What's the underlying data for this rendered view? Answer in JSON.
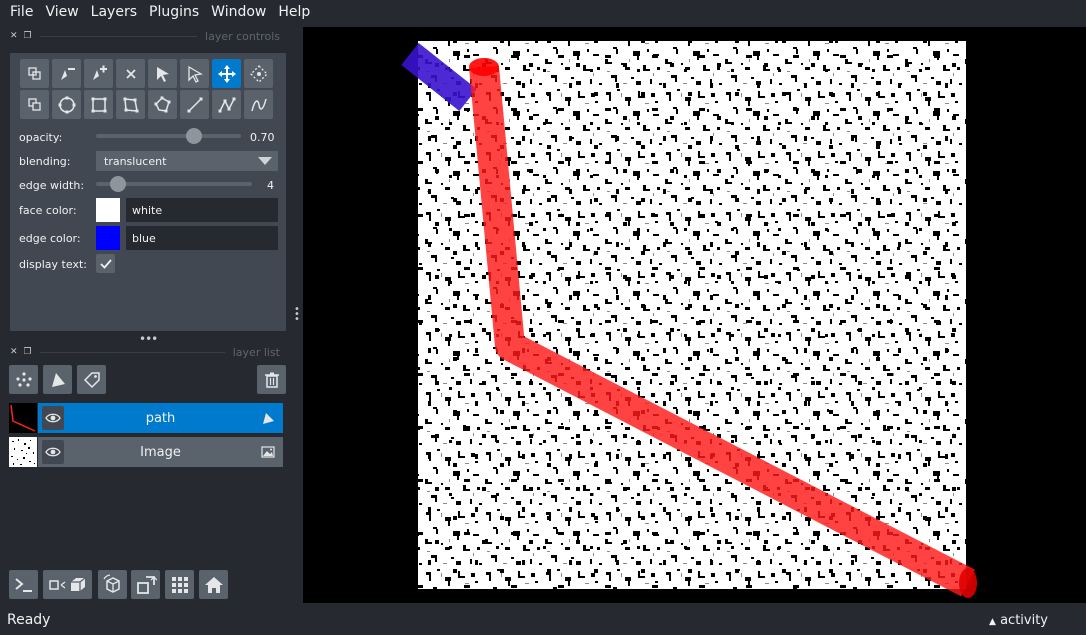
{
  "menu": [
    "File",
    "View",
    "Layers",
    "Plugins",
    "Window",
    "Help"
  ],
  "layer_controls": {
    "title": "layer controls",
    "opacity": {
      "label": "opacity:",
      "value": "0.70",
      "level": 0.7
    },
    "blending": {
      "label": "blending:",
      "value": "translucent"
    },
    "edge_width": {
      "label": "edge width:",
      "value": "4",
      "level": 0.1
    },
    "face_color": {
      "label": "face color:",
      "value": "white",
      "swatch": "#ffffff"
    },
    "edge_color": {
      "label": "edge color:",
      "value": "blue",
      "swatch": "#0000ff"
    },
    "display_text": {
      "label": "display text:",
      "checked": true
    }
  },
  "layer_list": {
    "title": "layer list",
    "layers": [
      {
        "name": "path",
        "selected": true,
        "type_icon": "shapes-icon"
      },
      {
        "name": "Image",
        "selected": false,
        "type_icon": "image-icon"
      }
    ]
  },
  "status": {
    "text": "Ready",
    "activity": "activity"
  },
  "colors": {
    "accent": "#007acc",
    "panel": "#414851",
    "background": "#262930",
    "button": "#5a626c"
  }
}
